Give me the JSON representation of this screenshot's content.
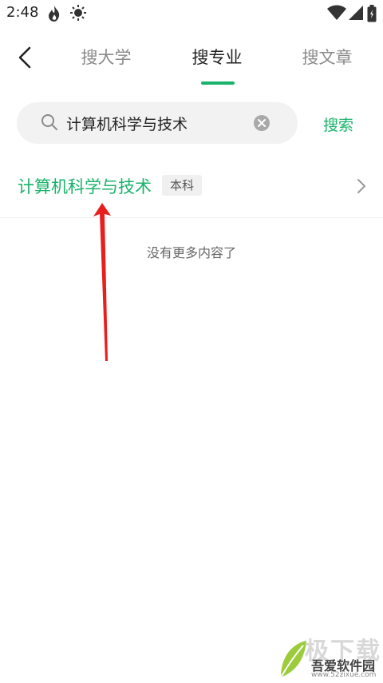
{
  "status_bar": {
    "time": "2:48",
    "left_icons": [
      "flame-icon",
      "brightness-icon"
    ],
    "right_icons": [
      "wifi-icon",
      "signal-icon",
      "battery-icon"
    ]
  },
  "nav": {
    "back_icon": "chevron-left-icon",
    "tabs": [
      {
        "label": "搜大学",
        "active": false
      },
      {
        "label": "搜专业",
        "active": true
      },
      {
        "label": "搜文章",
        "active": false
      }
    ],
    "accent_color": "#19b36b"
  },
  "search": {
    "value": "计算机科学与技术",
    "button_label": "搜索"
  },
  "results": [
    {
      "title": "计算机科学与技术",
      "badge": "本科"
    }
  ],
  "footer_text": "没有更多内容了",
  "watermark": {
    "bg_text": "极下载",
    "main_text": "吾爱软件园",
    "url": "www.52zixue.com"
  }
}
